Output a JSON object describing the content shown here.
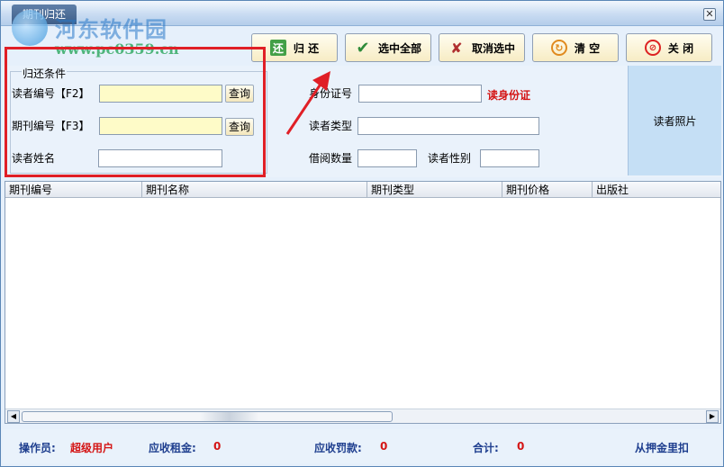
{
  "window": {
    "title": "期刊归还",
    "close_symbol": "✕"
  },
  "watermark": {
    "line1": "河东软件园",
    "line2": "www.pc0359.cn"
  },
  "toolbar": {
    "return_label": "归 还",
    "return_icon_glyph": "还",
    "select_all_label": "选中全部",
    "deselect_label": "取消选中",
    "clear_label": "清 空",
    "close_label": "关 闭"
  },
  "form": {
    "group_title": "归还条件",
    "reader_id_label": "读者编号【F2】",
    "reader_id_value": "",
    "journal_id_label": "期刊编号【F3】",
    "journal_id_value": "",
    "query_label": "查询",
    "reader_name_label": "读者姓名",
    "reader_name_value": "",
    "id_card_label": "身份证号",
    "id_card_value": "",
    "read_id_card": "读身份证",
    "reader_type_label": "读者类型",
    "reader_type_value": "",
    "borrow_count_label": "借阅数量",
    "borrow_count_value": "",
    "reader_gender_label": "读者性别",
    "reader_gender_value": "",
    "photo_label": "读者照片"
  },
  "table": {
    "columns": [
      "期刊编号",
      "期刊名称",
      "期刊类型",
      "期刊价格",
      "出版社"
    ],
    "rows": []
  },
  "status": {
    "operator_label": "操作员:",
    "operator_value": "超级用户",
    "rent_label": "应收租金:",
    "rent_value": "0",
    "fine_label": "应收罚款:",
    "fine_value": "0",
    "total_label": "合计:",
    "total_value": "0",
    "deposit_label": "从押金里扣"
  },
  "colors": {
    "highlight": "#e01f26",
    "accent_red": "#d41515",
    "status_blue": "#1f3f8f"
  }
}
